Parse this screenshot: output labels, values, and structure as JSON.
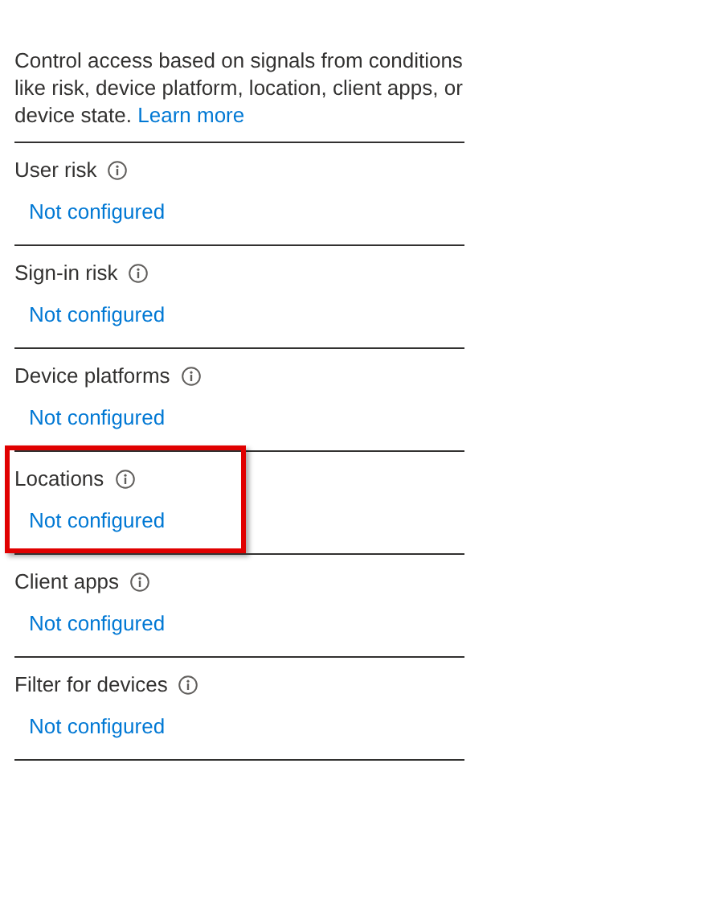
{
  "description": {
    "text": "Control access based on signals from conditions like risk, device platform, location, client apps, or device state.",
    "link": "Learn more"
  },
  "conditions": [
    {
      "label": "User risk",
      "value": "Not configured",
      "highlighted": false
    },
    {
      "label": "Sign-in risk",
      "value": "Not configured",
      "highlighted": false
    },
    {
      "label": "Device platforms",
      "value": "Not configured",
      "highlighted": false
    },
    {
      "label": "Locations",
      "value": "Not configured",
      "highlighted": true
    },
    {
      "label": "Client apps",
      "value": "Not configured",
      "highlighted": false
    },
    {
      "label": "Filter for devices",
      "value": "Not configured",
      "highlighted": false
    }
  ]
}
